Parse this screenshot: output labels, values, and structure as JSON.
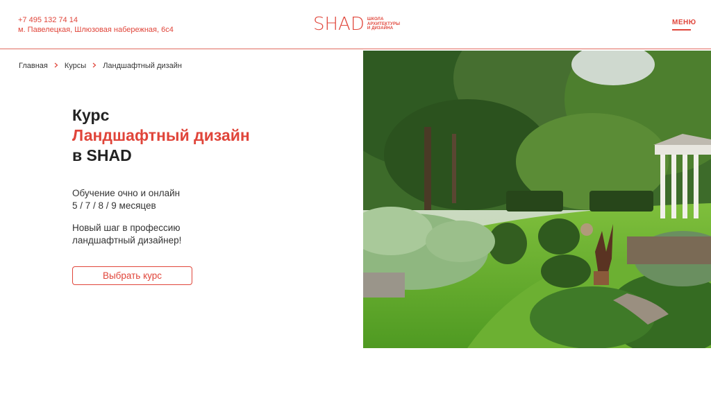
{
  "header": {
    "phone": "+7 495 132 74 14",
    "address": "м. Павелецкая, Шлюзовая набережная, 6с4",
    "logo_mark": "SHAD",
    "logo_sub_1": "школа",
    "logo_sub_2": "архитектуры",
    "logo_sub_3": "и дизайна",
    "menu_label": "МЕНЮ"
  },
  "breadcrumb": {
    "items": [
      "Главная",
      "Курсы",
      "Ландшафтный дизайн"
    ],
    "separator": ">"
  },
  "hero": {
    "title_line1": "Курс",
    "title_accent": "Ландшафтный дизайн",
    "title_line3": "в SHAD",
    "desc_line1": "Обучение очно и онлайн",
    "desc_line2": "5 / 7 / 8 / 9 месяцев",
    "desc2_line1": "Новый шаг в профессию",
    "desc2_line2": "ландшафтный дизайнер!",
    "cta_label": "Выбрать курс"
  },
  "colors": {
    "accent": "#e0453a",
    "text": "#222222"
  }
}
